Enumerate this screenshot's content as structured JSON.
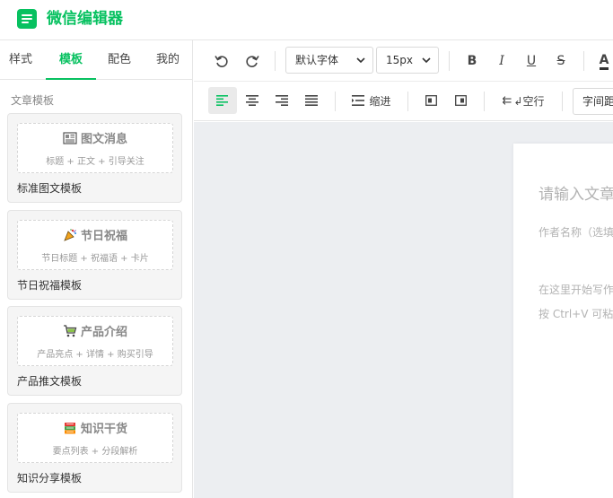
{
  "app": {
    "title": "微信编辑器",
    "brand_color": "#07c160"
  },
  "sidebar": {
    "tabs": [
      {
        "label": "样式",
        "active": false
      },
      {
        "label": "模板",
        "active": true
      },
      {
        "label": "配色",
        "active": false
      },
      {
        "label": "我的",
        "active": false
      }
    ],
    "section_title": "文章模板",
    "templates": [
      {
        "icon": "newspaper-icon",
        "heading": "图文消息",
        "subtitle": "标题 + 正文 + 引导关注",
        "label": "标准图文模板"
      },
      {
        "icon": "party-icon",
        "heading": "节日祝福",
        "subtitle": "节日标题 + 祝福语 + 卡片",
        "label": "节日祝福模板"
      },
      {
        "icon": "cart-icon",
        "heading": "产品介绍",
        "subtitle": "产品亮点 + 详情 + 购买引导",
        "label": "产品推文模板"
      },
      {
        "icon": "books-icon",
        "heading": "知识干货",
        "subtitle": "要点列表 + 分段解析",
        "label": "知识分享模板"
      }
    ]
  },
  "toolbar": {
    "undo_icon": "undo-icon",
    "redo_icon": "redo-icon",
    "font_family": "默认字体",
    "font_size": "15px",
    "bold": "B",
    "italic": "I",
    "underline": "U",
    "strike": "S",
    "font_color": "A",
    "indent_label": "缩进",
    "line_break_label": "↲空行",
    "letter_spacing": "字间距"
  },
  "editor": {
    "title_placeholder": "请输入文章标题",
    "author_placeholder": "作者名称（选填）",
    "body_placeholder_1": "在这里开始写作...",
    "body_placeholder_2": "按 Ctrl+V 可粘贴内容"
  }
}
